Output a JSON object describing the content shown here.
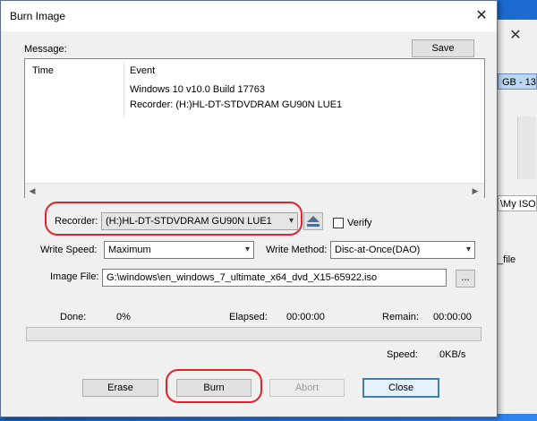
{
  "dialog": {
    "title": "Burn Image",
    "close_glyph": "✕"
  },
  "background": {
    "close_glyph": "✕",
    "size_text": "GB - 13",
    "path_text": "\\My ISO",
    "file_text": "_file"
  },
  "message": {
    "label": "Message:",
    "save_label": "Save",
    "columns": [
      "Time",
      "Event"
    ],
    "lines": [
      "Windows 10 v10.0 Build 17763",
      "Recorder: (H:)HL-DT-STDVDRAM GU90N    LUE1"
    ]
  },
  "recorder": {
    "label": "Recorder:",
    "value": "(H:)HL-DT-STDVDRAM GU90N    LUE1",
    "verify_label": "Verify",
    "verify_checked": false
  },
  "write_speed": {
    "label": "Write Speed:",
    "value": "Maximum"
  },
  "write_method": {
    "label": "Write Method:",
    "value": "Disc-at-Once(DAO)"
  },
  "image_file": {
    "label": "Image File:",
    "value": "G:\\windows\\en_windows_7_ultimate_x64_dvd_X15-65922.iso",
    "browse_label": "..."
  },
  "status": {
    "done_label": "Done:",
    "done_value": "0%",
    "progress_fraction": 0,
    "elapsed_label": "Elapsed:",
    "elapsed_value": "00:00:00",
    "remain_label": "Remain:",
    "remain_value": "00:00:00",
    "speed_label": "Speed:",
    "speed_value": "0KB/s"
  },
  "buttons": {
    "erase": "Erase",
    "burn": "Burn",
    "abort": "Abort",
    "close": "Close"
  },
  "colors": {
    "annotation": "#e0222a",
    "progress": "#06b025"
  }
}
